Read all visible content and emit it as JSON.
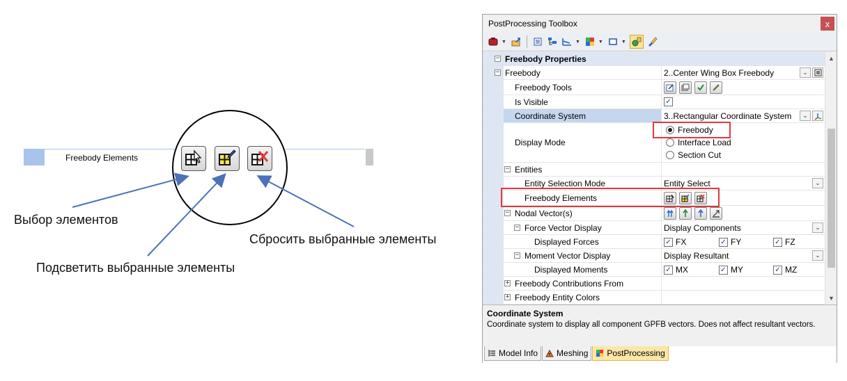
{
  "annotation": {
    "field_label": "Freebody Elements",
    "callouts": {
      "select": "Выбор элементов",
      "highlight": "Подсветить выбранные элементы",
      "reset": "Сбросить выбранные элементы"
    }
  },
  "panel": {
    "title": "PostProcessing Toolbox",
    "close": "x",
    "description": {
      "title": "Coordinate System",
      "text": "Coordinate system to display all component GPFB vectors. Does not affect resultant vectors."
    },
    "tabs": [
      {
        "label": "Model Info",
        "active": false
      },
      {
        "label": "Meshing",
        "active": false
      },
      {
        "label": "PostProcessing",
        "active": true
      }
    ]
  },
  "grid": {
    "category": "Freebody Properties",
    "freebody": {
      "name": "Freebody",
      "value": "2..Center Wing Box Freebody"
    },
    "freebody_tools": {
      "name": "Freebody Tools"
    },
    "is_visible": {
      "name": "Is Visible",
      "checked": true
    },
    "coordinate_system": {
      "name": "Coordinate System",
      "value": "3..Rectangular Coordinate System"
    },
    "display_mode": {
      "name": "Display Mode",
      "options": [
        "Freebody",
        "Interface Load",
        "Section Cut"
      ],
      "selected": "Freebody"
    },
    "entities": {
      "name": "Entities"
    },
    "entity_selection_mode": {
      "name": "Entity Selection Mode",
      "value": "Entity Select"
    },
    "freebody_elements": {
      "name": "Freebody Elements"
    },
    "nodal_vectors": {
      "name": "Nodal Vector(s)"
    },
    "force_vector_display": {
      "name": "Force Vector Display",
      "value": "Display Components"
    },
    "displayed_forces": {
      "name": "Displayed Forces",
      "components": [
        "FX",
        "FY",
        "FZ"
      ]
    },
    "moment_vector_display": {
      "name": "Moment Vector Display",
      "value": "Display Resultant"
    },
    "displayed_moments": {
      "name": "Displayed Moments",
      "components": [
        "MX",
        "MY",
        "MZ"
      ]
    },
    "contributions": {
      "name": "Freebody Contributions From"
    },
    "entity_colors": {
      "name": "Freebody Entity Colors"
    }
  },
  "colors": {
    "highlight_box": "#e0393e",
    "arrow": "#4a72b8",
    "category_bg": "#dde6f3",
    "active_tab": "#fce6a8"
  }
}
